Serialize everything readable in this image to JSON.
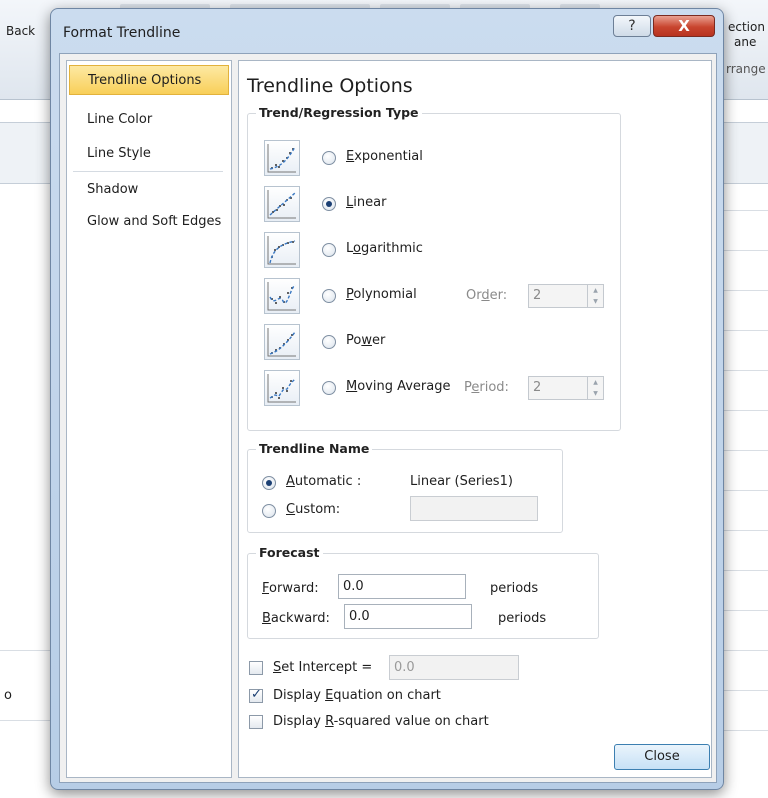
{
  "background": {
    "ribbon_left_label": "Back",
    "ribbon_right_label_1": "ection",
    "ribbon_right_label_2": "ane",
    "ribbon_right_label_3": "rrange",
    "sheet_fragment": "o"
  },
  "dialog": {
    "title": "Format Trendline",
    "help_glyph": "?",
    "close_glyph": "X"
  },
  "nav": {
    "items": [
      {
        "label": "Trendline Options"
      },
      {
        "label": "Line Color"
      },
      {
        "label": "Line Style"
      },
      {
        "label": "Shadow"
      },
      {
        "label": "Glow and Soft Edges"
      }
    ]
  },
  "panel": {
    "heading": "Trendline Options",
    "trend_type": {
      "legend": "Trend/Regression Type",
      "options": [
        {
          "label_pre": "",
          "label_key": "E",
          "label_post": "xponential",
          "checked": false
        },
        {
          "label_pre": "",
          "label_key": "L",
          "label_post": "inear",
          "checked": true
        },
        {
          "label_pre": "L",
          "label_key": "o",
          "label_post": "garithmic",
          "checked": false
        },
        {
          "label_pre": "",
          "label_key": "P",
          "label_post": "olynomial",
          "checked": false
        },
        {
          "label_pre": "Po",
          "label_key": "w",
          "label_post": "er",
          "checked": false
        },
        {
          "label_pre": "",
          "label_key": "M",
          "label_post": "oving Average",
          "checked": false
        }
      ],
      "order": {
        "label_pre": "Or",
        "label_key": "d",
        "label_post": "er:",
        "value": "2"
      },
      "period": {
        "label_pre": "P",
        "label_key": "e",
        "label_post": "riod:",
        "value": "2"
      }
    },
    "trendline_name": {
      "legend": "Trendline Name",
      "automatic": {
        "label_key": "A",
        "label_post": "utomatic :",
        "value": "Linear (Series1)",
        "checked": true
      },
      "custom": {
        "label_key": "C",
        "label_post": "ustom:",
        "value": "",
        "checked": false
      }
    },
    "forecast": {
      "legend": "Forecast",
      "forward": {
        "label_key": "F",
        "label_post": "orward:",
        "value": "0.0",
        "unit": "periods"
      },
      "backward": {
        "label_key": "B",
        "label_post": "ackward:",
        "value": "0.0",
        "unit": "periods"
      }
    },
    "set_intercept": {
      "label_key": "S",
      "label_post": "et Intercept =",
      "value": "0.0",
      "checked": false
    },
    "display_equation": {
      "label_pre": "Display ",
      "label_key": "E",
      "label_post": "quation on chart",
      "checked": true
    },
    "display_rsquared": {
      "label_pre": "Display ",
      "label_key": "R",
      "label_post": "-squared value on chart",
      "checked": false
    }
  },
  "buttons": {
    "close": "Close"
  }
}
